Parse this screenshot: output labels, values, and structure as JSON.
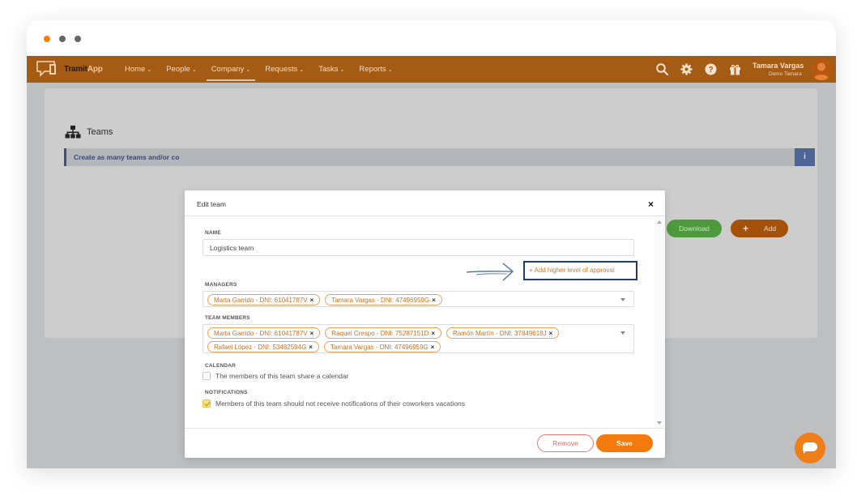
{
  "app": {
    "logo_text": "Tramit",
    "logo_app": "App"
  },
  "nav": [
    {
      "label": "Home"
    },
    {
      "label": "People"
    },
    {
      "label": "Company",
      "active": true
    },
    {
      "label": "Requests"
    },
    {
      "label": "Tasks"
    },
    {
      "label": "Reports"
    }
  ],
  "header_icons": [
    "search-icon",
    "gear-icon",
    "help-icon",
    "gift-icon"
  ],
  "user": {
    "name": "Tamara Vargas",
    "company": "Demo Tamara"
  },
  "page": {
    "title": "Teams",
    "info_text": "Create as many teams and/or co",
    "info_button": "i",
    "download_label": "Download",
    "add_plus": "+",
    "add_label": "Add"
  },
  "modal": {
    "title": "Edit team",
    "close": "×",
    "name_label": "NAME",
    "name_value": "Logistics team",
    "approval_link": "+  Add higher level of approval",
    "managers_label": "MANAGERS",
    "managers": [
      "Marta Garrido - DNI: 61041787V",
      "Tamara Vargas - DNI: 47496959G"
    ],
    "members_label": "TEAM MEMBERS",
    "members_row1": [
      "Marta Garrido - DNI: 61041787V",
      "Raquel Crespo - DNI: 75287151D",
      "Ramón Martín - DNI: 37849618J"
    ],
    "members_row2": [
      "Rafael López - DNI: 53482594G",
      "Tamara Vargas - DNI: 47496959G"
    ],
    "chip_remove": "×",
    "calendar_label": "CALENDAR",
    "calendar_text": "The members of this team share a calendar",
    "calendar_checked": false,
    "notifications_label": "NOTIFICATIONS",
    "notifications_text": "Members of this team should not receive notifications of their coworkers vacations",
    "notifications_checked": true,
    "remove_label": "Remove",
    "save_label": "Save"
  },
  "colors": {
    "brand_orange": "#f47a0d",
    "appbar": "#a45b14",
    "highlight_box": "#1c3d7a",
    "download_green": "#4d9a3d"
  }
}
